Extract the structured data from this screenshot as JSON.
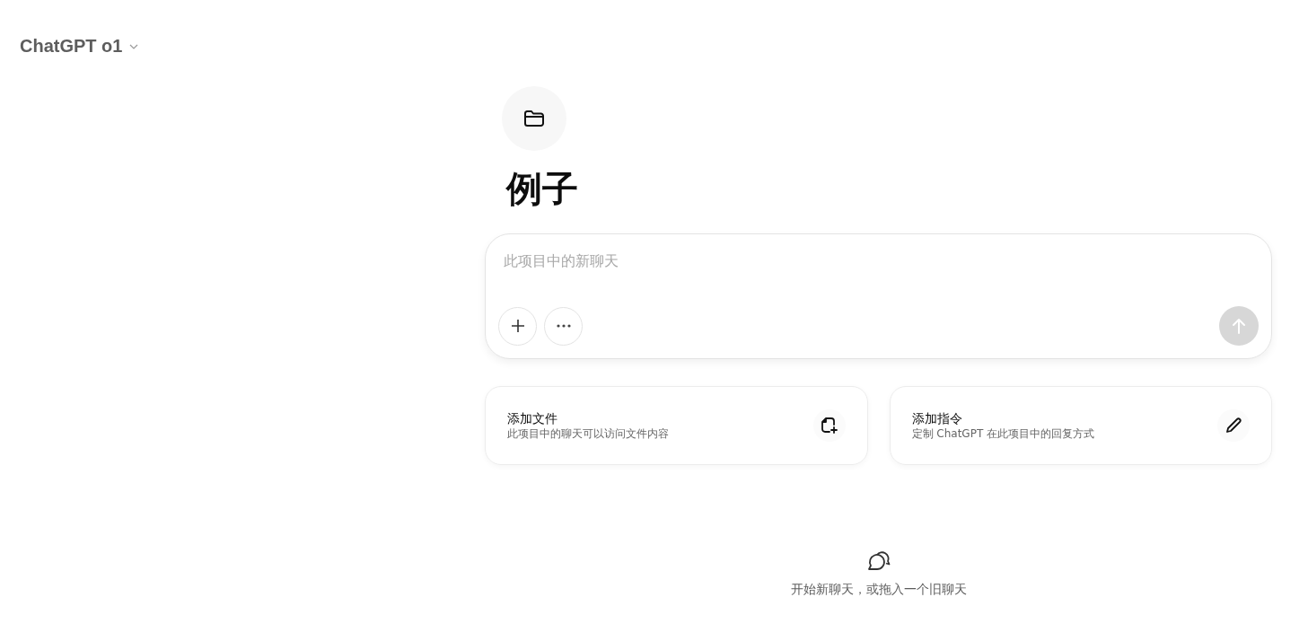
{
  "model_selector": {
    "label": "ChatGPT o1"
  },
  "project": {
    "title": "例子"
  },
  "composer": {
    "placeholder": "此项目中的新聊天",
    "send_disabled": true
  },
  "cards": [
    {
      "title": "添加文件",
      "description": "此项目中的聊天可以访问文件内容"
    },
    {
      "title": "添加指令",
      "description": "定制 ChatGPT 在此项目中的回复方式"
    }
  ],
  "empty_state": {
    "text": "开始新聊天，或拖入一个旧聊天"
  }
}
